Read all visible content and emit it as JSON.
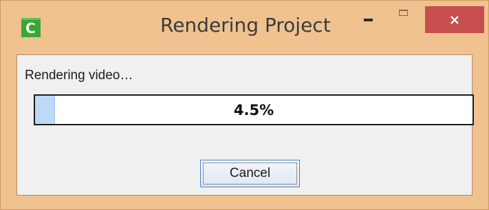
{
  "window": {
    "title": "Rendering Project",
    "icon": "camtasia-app-icon",
    "controls": {
      "minimize": "minimize-icon",
      "maximize": "maximize-icon",
      "close": "close-icon"
    }
  },
  "dialog": {
    "status_text": "Rendering video…",
    "progress": {
      "value_percent": 4.5,
      "label": "4.5%"
    },
    "cancel_label": "Cancel"
  },
  "colors": {
    "frame": "#f0c28f",
    "client_background": "#f0f0f0",
    "progress_fill": "#bcd9f5",
    "close_button": "#c74f4f",
    "app_icon": "#3aa63a"
  }
}
